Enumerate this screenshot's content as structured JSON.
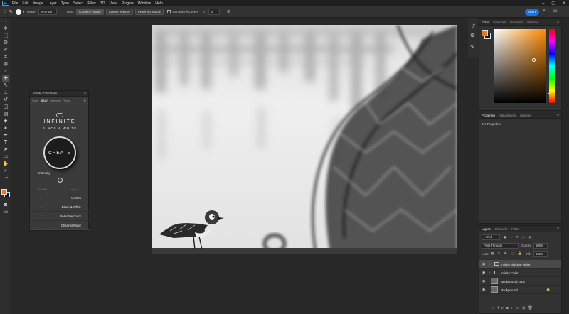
{
  "menu": {
    "logo": "Ps",
    "items": [
      "File",
      "Edit",
      "Image",
      "Layer",
      "Type",
      "Select",
      "Filter",
      "3D",
      "View",
      "Plugins",
      "Window",
      "Help"
    ]
  },
  "options": {
    "mode_label": "Mode:",
    "mode_value": "Normal",
    "type_label": "Type:",
    "content_aware": "Content-Aware",
    "create_texture": "Create Texture",
    "proximity_match": "Proximity Match",
    "sample_all_layers": "Sample All Layers",
    "angle_value": "0°",
    "share": "Share"
  },
  "plugin": {
    "title": "Infinite Color Suite",
    "tabs": [
      "Color",
      "B&W",
      "Harmony",
      "Tools"
    ],
    "active_tab": "B&W",
    "brand_line1": "INFINITE",
    "brand_line2": "BLACK & WHITE",
    "create_button": "CREATE",
    "intensity_label": "Intensity",
    "intensity_value": 0.5,
    "shuffle_label": "Shuffle",
    "undo_label": "undo",
    "adjustments": [
      "Curves",
      "Black & White",
      "Selective Color",
      "Channel Mixer"
    ]
  },
  "color_panel": {
    "tabs": [
      "Color",
      "Swatches",
      "Gradients",
      "Patterns"
    ],
    "active_tab": "Color",
    "foreground": "#e8771e",
    "background": "#1a1a1a"
  },
  "properties_panel": {
    "tabs": [
      "Properties",
      "Adjustments",
      "Libraries"
    ],
    "active_tab": "Properties",
    "empty_text": "No Properties"
  },
  "layers_panel": {
    "tabs": [
      "Layers",
      "Channels",
      "Paths"
    ],
    "active_tab": "Layers",
    "filter_kind": "Kind",
    "blend_mode": "Pass Through",
    "opacity_label": "Opacity:",
    "opacity_value": "100%",
    "lock_label": "Lock:",
    "fill_label": "Fill:",
    "fill_value": "100%",
    "layers": [
      {
        "name": "Infinite Black & White",
        "type": "group"
      },
      {
        "name": "Infinite Color",
        "type": "group"
      },
      {
        "name": "Background copy",
        "type": "pixel"
      },
      {
        "name": "Background",
        "type": "pixel"
      }
    ]
  }
}
